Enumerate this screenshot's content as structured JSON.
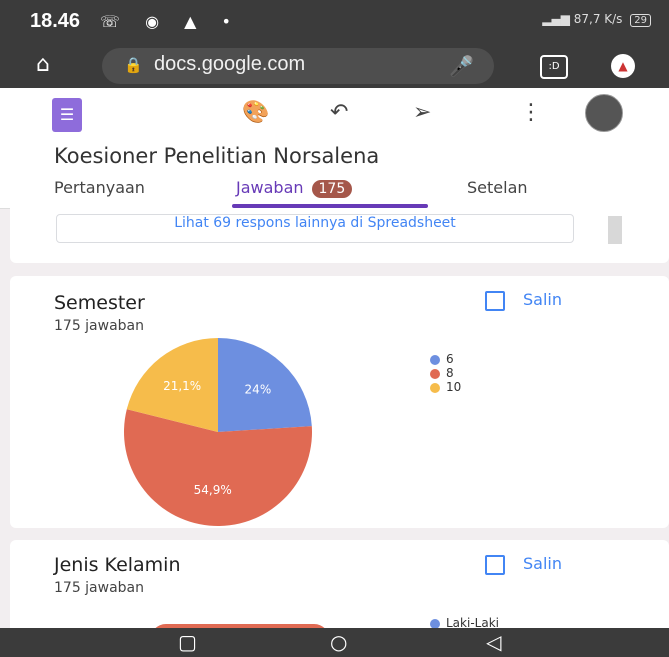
{
  "status_bar": {
    "time": "18.46",
    "network": "87,7 K/s",
    "battery": "29"
  },
  "browser": {
    "url": "docs.google.com",
    "tab_count": ":D"
  },
  "form": {
    "title": "Koesioner Penelitian Norsalena",
    "tabs": [
      {
        "label": "Pertanyaan"
      },
      {
        "label": "Jawaban",
        "count": "175"
      },
      {
        "label": "Setelan"
      }
    ]
  },
  "more_link": "Lihat 69 respons lainnya di Spreadsheet",
  "questions": [
    {
      "title": "Semester",
      "count": "175 jawaban",
      "copy_label": "Salin",
      "chart_data": {
        "type": "pie",
        "categories": [
          "6",
          "8",
          "10"
        ],
        "values": [
          24,
          54.9,
          21.1
        ],
        "value_labels": [
          "24%",
          "54,9%",
          "21,1%"
        ],
        "colors": [
          "#6d8fe0",
          "#e06a53",
          "#f6bc4b"
        ],
        "legend": "right"
      }
    },
    {
      "title": "Jenis Kelamin",
      "count": "175 jawaban",
      "copy_label": "Salin",
      "legend_first": "Laki-Laki"
    }
  ]
}
